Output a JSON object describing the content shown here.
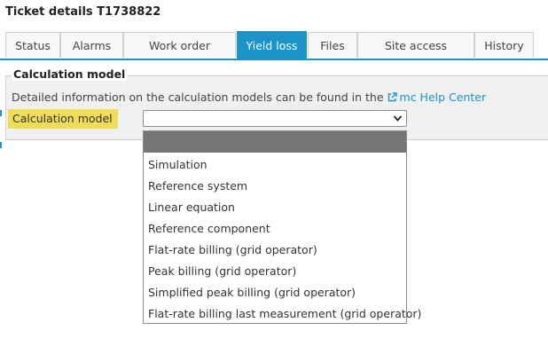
{
  "title": "Ticket details T1738822",
  "tabs": [
    {
      "label": "Status",
      "active": false
    },
    {
      "label": "Alarms",
      "active": false
    },
    {
      "label": "Work order",
      "active": false
    },
    {
      "label": "Yield loss",
      "active": true
    },
    {
      "label": "Files",
      "active": false
    },
    {
      "label": "Site access",
      "active": false
    },
    {
      "label": "History",
      "active": false
    }
  ],
  "section": {
    "legend": "Calculation model",
    "info_text": "Detailed information on the calculation models can be found in the",
    "help_link_label": "mc Help Center",
    "field_label": "Calculation model",
    "selected_value": ""
  },
  "dropdown": {
    "options": [
      "Simulation",
      "Reference system",
      "Linear equation",
      "Reference component",
      "Flat-rate billing (grid operator)",
      "Peak billing (grid operator)",
      "Simplified peak billing (grid operator)",
      "Flat-rate billing last measurement (grid operator)"
    ]
  },
  "colors": {
    "accent": "#1a94c9",
    "highlight": "#f1dc57",
    "dropdown_highlight": "#767676"
  }
}
